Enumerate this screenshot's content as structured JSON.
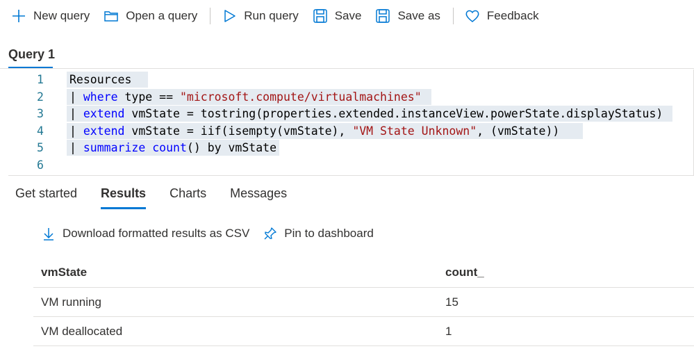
{
  "toolbar": {
    "new_query": "New query",
    "open_query": "Open a query",
    "run_query": "Run query",
    "save": "Save",
    "save_as": "Save as",
    "feedback": "Feedback"
  },
  "query_tab": {
    "label": "Query 1"
  },
  "editor": {
    "lines": [
      {
        "num": "1",
        "text": "Resources"
      },
      {
        "num": "2",
        "text": "| where type == \"microsoft.compute/virtualmachines\""
      },
      {
        "num": "3",
        "text": "| extend vmState = tostring(properties.extended.instanceView.powerState.displayStatus)"
      },
      {
        "num": "4",
        "text": "| extend vmState = iif(isempty(vmState), \"VM State Unknown\", (vmState))"
      },
      {
        "num": "5",
        "text": "| summarize count() by vmState"
      },
      {
        "num": "6",
        "text": ""
      }
    ]
  },
  "results_tabs": [
    "Get started",
    "Results",
    "Charts",
    "Messages"
  ],
  "active_results_tab": "Results",
  "actions": {
    "download": "Download formatted results as CSV",
    "pin": "Pin to dashboard"
  },
  "table": {
    "columns": [
      "vmState",
      "count_"
    ],
    "rows": [
      [
        "VM running",
        "15"
      ],
      [
        "VM deallocated",
        "1"
      ]
    ]
  },
  "colors": {
    "accent": "#0078d4",
    "keyword": "#0000ff",
    "string": "#a31515",
    "line_number": "#237893"
  }
}
